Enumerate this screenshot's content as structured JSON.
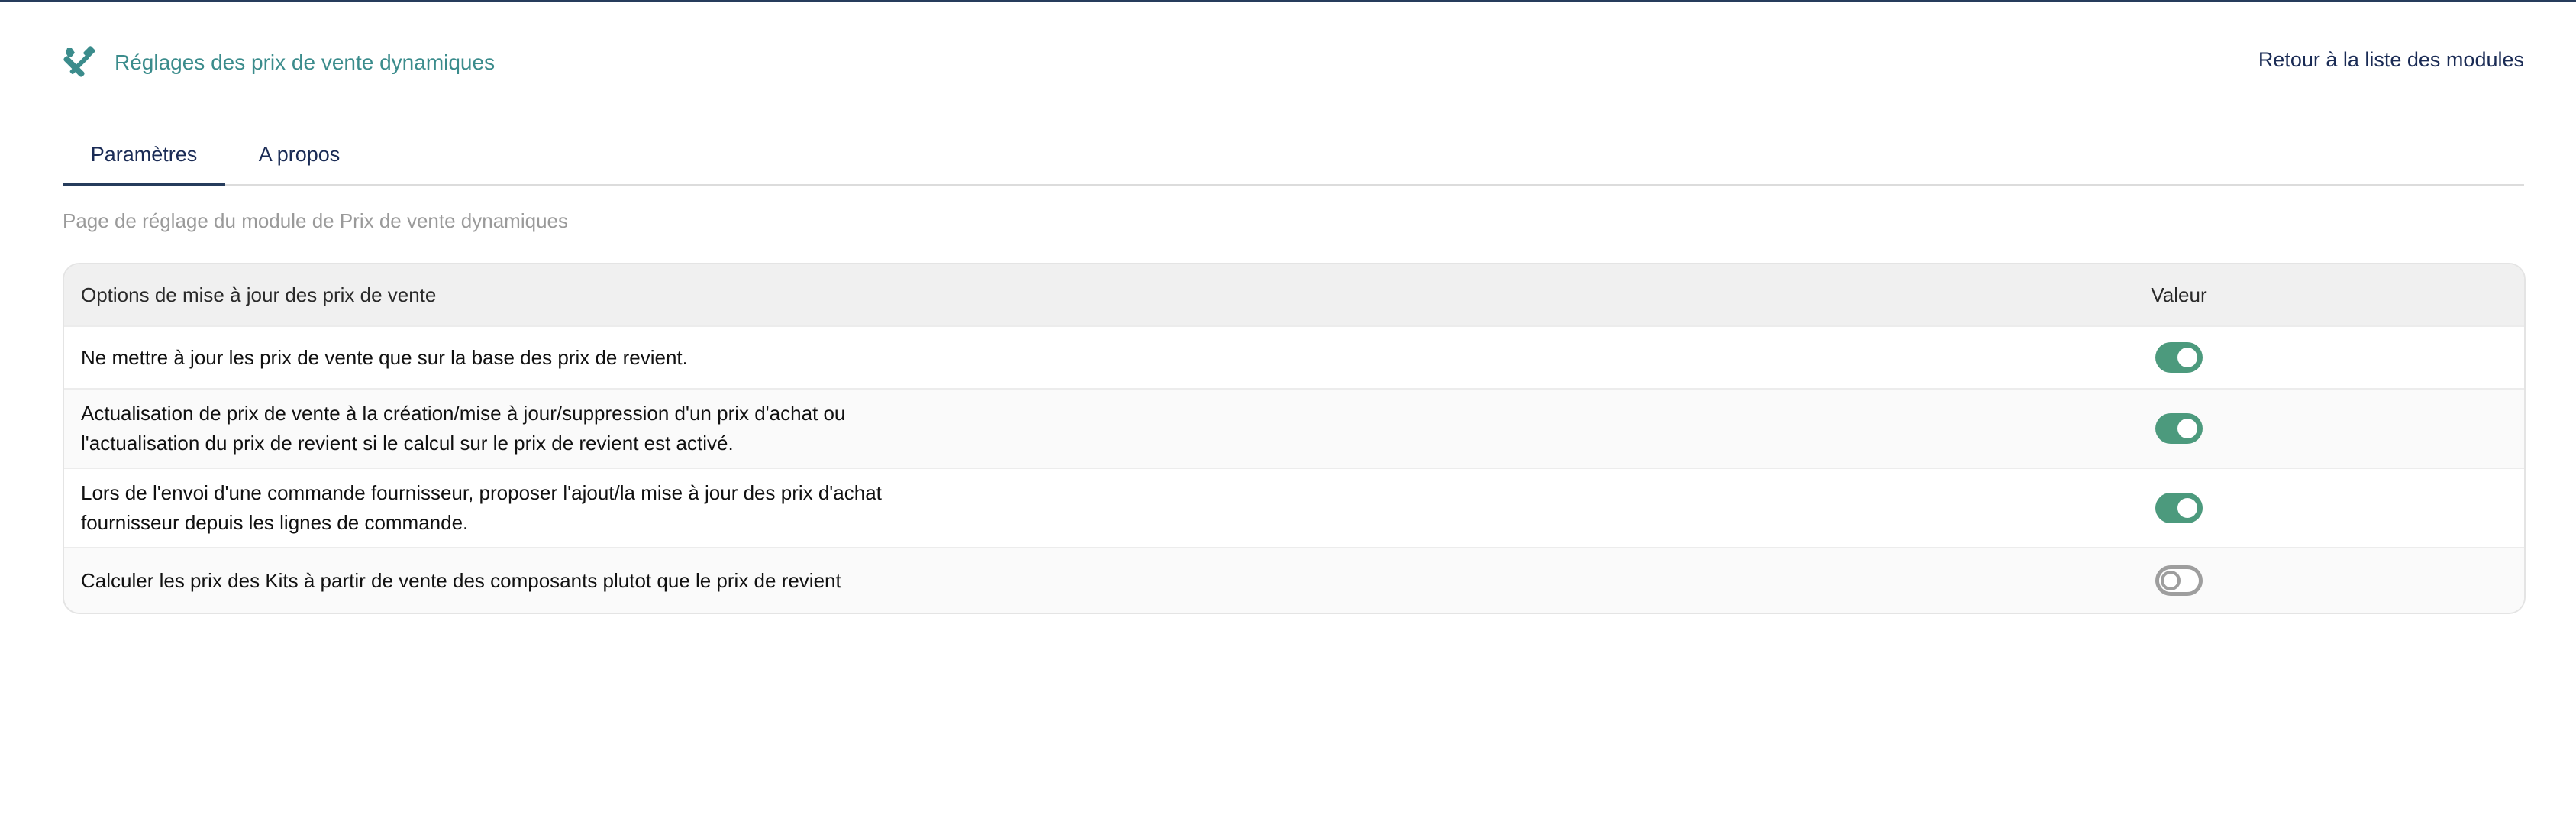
{
  "header": {
    "title": "Réglages des prix de vente dynamiques",
    "title_icon": "tools-icon",
    "back_link": "Retour à la liste des modules"
  },
  "tabs": [
    {
      "label": "Paramètres",
      "active": true
    },
    {
      "label": "A propos",
      "active": false
    }
  ],
  "subtitle": "Page de réglage du module de Prix de vente dynamiques",
  "table": {
    "columns": [
      "Options de mise à jour des prix de vente",
      "Valeur"
    ],
    "rows": [
      {
        "label": "Ne mettre à jour les prix de vente que sur la base des prix de revient.",
        "enabled": true
      },
      {
        "label": "Actualisation de prix de vente à la création/mise à jour/suppression d'un prix d'achat ou l'actualisation du prix de revient si le calcul sur le prix de revient est activé.",
        "enabled": true
      },
      {
        "label": "Lors de l'envoi d'une commande fournisseur, proposer l'ajout/la mise à jour des prix d'achat fournisseur depuis les lignes de commande.",
        "enabled": true
      },
      {
        "label": "Calculer les prix des Kits à partir de vente des composants plutot que le prix de revient",
        "enabled": false
      }
    ]
  },
  "colors": {
    "accent": "#3b8c8c",
    "link": "#1a2b55",
    "toggle_on": "#4c9a7d",
    "toggle_off": "#9e9e9e"
  }
}
